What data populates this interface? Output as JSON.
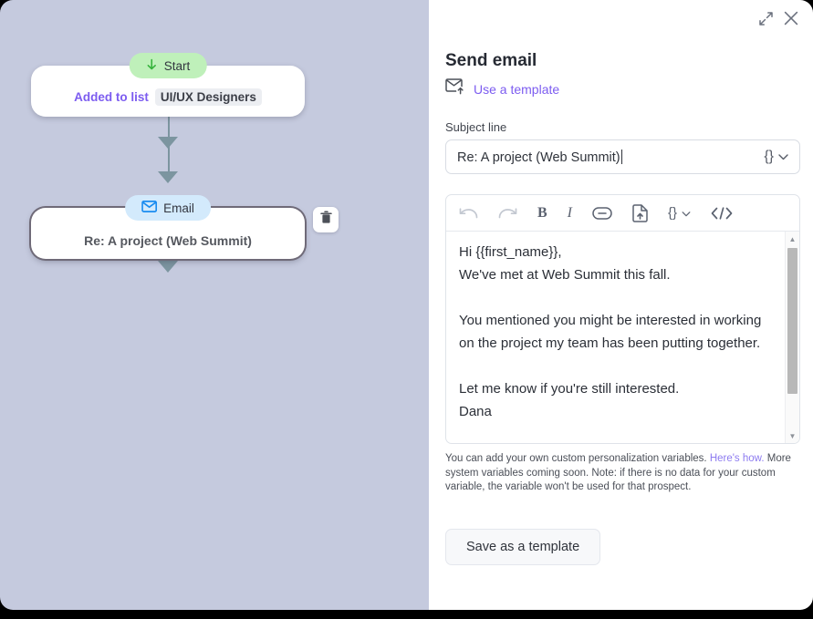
{
  "panel": {
    "title": "Send email",
    "expand_icon": "expand-arrows-icon",
    "close_icon": "close-icon",
    "use_template_label": "Use a template",
    "use_template_icon": "envelope-upload-icon",
    "subject_label": "Subject line",
    "subject_value": "Re: A project (Web Summit)",
    "subject_placeholder": "Subject line",
    "variable_button_label": "{}",
    "variable_chevron": "⌄",
    "body_text": "Hi {{first_name}},\nWe've met at Web Summit this fall.\n\nYou mentioned you might be interested in working on the project my team has been putting together.\n\nLet me know if you're still interested.\nDana",
    "helper_text_1": "You can add your own custom personalization variables. ",
    "helper_link": "Here's how.",
    "helper_text_2": " More system variables coming soon. Note: if there is no data for your custom variable, the variable won't be used for that prospect.",
    "save_template_label": "Save as a template",
    "toolbar": [
      {
        "name": "undo-icon",
        "label": "undo",
        "disabled": true
      },
      {
        "name": "redo-icon",
        "label": "redo",
        "disabled": true
      },
      {
        "name": "bold-icon",
        "label": "B",
        "disabled": false
      },
      {
        "name": "italic-icon",
        "label": "I",
        "disabled": false
      },
      {
        "name": "link-icon",
        "label": "link",
        "disabled": false
      },
      {
        "name": "attach-file-icon",
        "label": "attach",
        "disabled": false
      },
      {
        "name": "variable-icon",
        "label": "{}",
        "disabled": false
      },
      {
        "name": "code-view-icon",
        "label": "</>",
        "disabled": false
      }
    ]
  },
  "flow": {
    "start_node": {
      "badge_label": "Start",
      "badge_icon": "arrow-down-icon",
      "trigger_label": "Added to list",
      "list_name": "UI/UX Designers"
    },
    "email_node": {
      "badge_label": "Email",
      "badge_icon": "envelope-icon",
      "subject": "Re: A project (Web Summit)",
      "delete_icon": "trash-icon"
    }
  },
  "colors": {
    "canvas_bg": "#c5cade",
    "accent_purple": "#7c5cf0",
    "start_badge": "#bff0ba",
    "email_badge": "#d3eafc",
    "connector": "#7c95a0"
  }
}
